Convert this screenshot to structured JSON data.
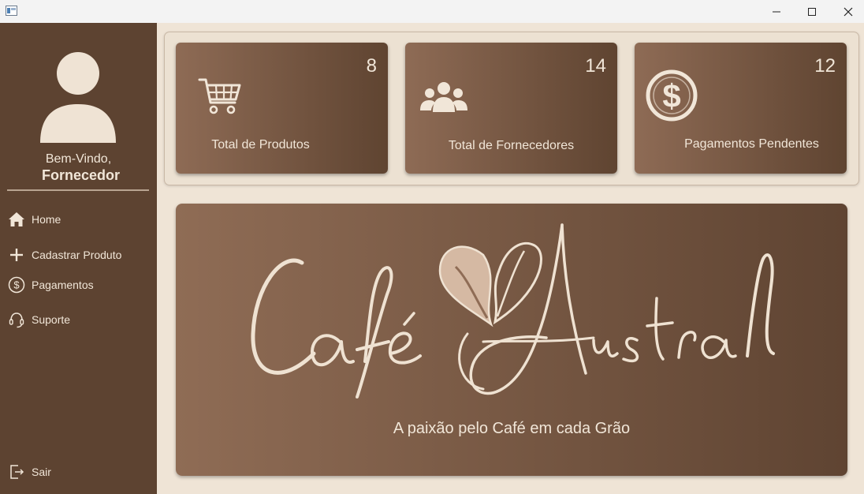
{
  "window": {
    "minimize_icon": "minimize-icon",
    "maximize_icon": "maximize-icon",
    "close_icon": "close-icon"
  },
  "sidebar": {
    "welcome": "Bem-Vindo,",
    "username": "Fornecedor",
    "items": [
      {
        "label": "Home",
        "icon": "home-icon"
      },
      {
        "label": "Cadastrar Produto",
        "icon": "plus-icon"
      },
      {
        "label": "Pagamentos",
        "icon": "dollar-circle-icon"
      },
      {
        "label": "Suporte",
        "icon": "headset-icon"
      }
    ],
    "logout": {
      "label": "Sair",
      "icon": "logout-icon"
    }
  },
  "cards": [
    {
      "count": "8",
      "label": "Total de Produtos",
      "icon": "cart-icon"
    },
    {
      "count": "14",
      "label": "Total de Fornecedores",
      "icon": "users-icon"
    },
    {
      "count": "12",
      "label": "Pagamentos Pendentes",
      "icon": "dollar-circle-icon"
    }
  ],
  "banner": {
    "logo_text": "Café Austral",
    "tagline": "A paixão pelo Café em cada Grão"
  },
  "colors": {
    "sidebar": "#5d4331",
    "background": "#efe4d6",
    "card_gradient_start": "#8e6b55",
    "card_gradient_end": "#5f4431",
    "text_light": "#f1e6d8"
  }
}
